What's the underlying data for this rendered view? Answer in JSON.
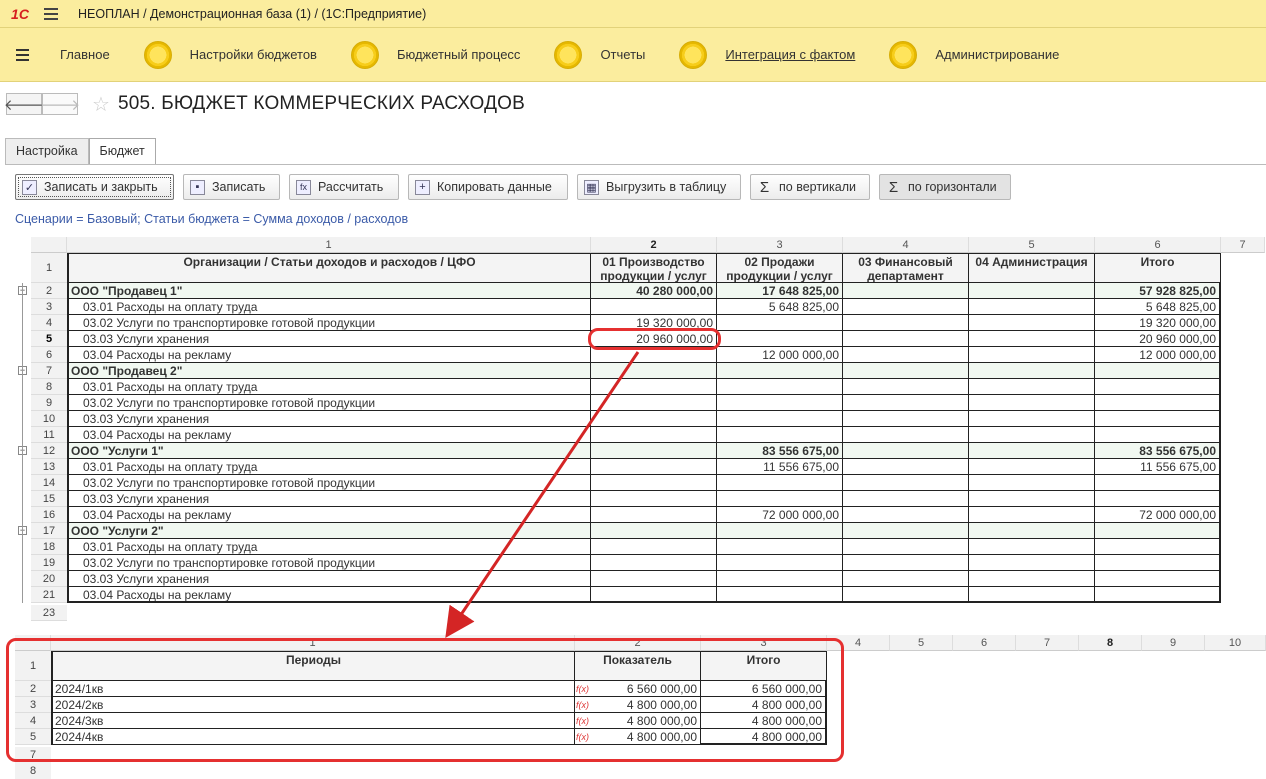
{
  "window": {
    "title": "НЕОПЛАН / Демонстрационная база (1) /  (1С:Предприятие)",
    "logo": "1С"
  },
  "menu": [
    {
      "label": "Главное",
      "link": false
    },
    {
      "label": "Настройки бюджетов",
      "link": false
    },
    {
      "label": "Бюджетный процесс",
      "link": false
    },
    {
      "label": "Отчеты",
      "link": false
    },
    {
      "label": "Интеграция с фактом",
      "link": true
    },
    {
      "label": "Администрирование",
      "link": false
    }
  ],
  "nav": {
    "back_icon": "arrow-left-icon",
    "forward_icon": "arrow-right-icon",
    "favorite_icon": "star-icon"
  },
  "page": {
    "title": "505. БЮДЖЕТ КОММЕРЧЕСКИХ РАСХОДОВ"
  },
  "tabs": [
    {
      "label": "Настройка",
      "active": false
    },
    {
      "label": "Бюджет",
      "active": true
    }
  ],
  "toolbar": {
    "save_close": "Записать и закрыть",
    "save": "Записать",
    "calc": "Рассчитать",
    "copy": "Копировать данные",
    "export": "Выгрузить в таблицу",
    "vertical": "по вертикали",
    "horizontal": "по горизонтали"
  },
  "filter": "Сценарии = Базовый; Статьи бюджета = Сумма доходов / расходов",
  "main_table": {
    "col_numbers": [
      "1",
      "2",
      "3",
      "4",
      "5",
      "6",
      "7"
    ],
    "headers": [
      "Организации / Статьи доходов и расходов / ЦФО",
      "01 Производство продукции / услуг",
      "02 Продажи продукции / услуг",
      "03 Финансовый департамент",
      "04 Администрация",
      "Итого"
    ],
    "rows": [
      {
        "n": "2",
        "group": true,
        "name": "ООО \"Продавец 1\"",
        "c2": "40 280 000,00",
        "c3": "17 648 825,00",
        "c4": "",
        "c5": "",
        "c6": "57 928 825,00"
      },
      {
        "n": "3",
        "group": false,
        "name": "03.01 Расходы на оплату труда",
        "c2": "",
        "c3": "5 648 825,00",
        "c4": "",
        "c5": "",
        "c6": "5 648 825,00"
      },
      {
        "n": "4",
        "group": false,
        "name": "03.02 Услуги по транспортировке готовой продукции",
        "c2": "19 320 000,00",
        "c3": "",
        "c4": "",
        "c5": "",
        "c6": "19 320 000,00"
      },
      {
        "n": "5",
        "group": false,
        "name": "03.03 Услуги хранения",
        "c2": "20 960 000,00",
        "c3": "",
        "c4": "",
        "c5": "",
        "c6": "20 960 000,00"
      },
      {
        "n": "6",
        "group": false,
        "name": "03.04 Расходы на рекламу",
        "c2": "",
        "c3": "12 000 000,00",
        "c4": "",
        "c5": "",
        "c6": "12 000 000,00"
      },
      {
        "n": "7",
        "group": true,
        "name": "ООО \"Продавец 2\"",
        "c2": "",
        "c3": "",
        "c4": "",
        "c5": "",
        "c6": ""
      },
      {
        "n": "8",
        "group": false,
        "name": "03.01 Расходы на оплату труда",
        "c2": "",
        "c3": "",
        "c4": "",
        "c5": "",
        "c6": ""
      },
      {
        "n": "9",
        "group": false,
        "name": "03.02 Услуги по транспортировке готовой продукции",
        "c2": "",
        "c3": "",
        "c4": "",
        "c5": "",
        "c6": ""
      },
      {
        "n": "10",
        "group": false,
        "name": "03.03 Услуги хранения",
        "c2": "",
        "c3": "",
        "c4": "",
        "c5": "",
        "c6": ""
      },
      {
        "n": "11",
        "group": false,
        "name": "03.04 Расходы на рекламу",
        "c2": "",
        "c3": "",
        "c4": "",
        "c5": "",
        "c6": ""
      },
      {
        "n": "12",
        "group": true,
        "name": "ООО \"Услуги 1\"",
        "c2": "",
        "c3": "83 556 675,00",
        "c4": "",
        "c5": "",
        "c6": "83 556 675,00"
      },
      {
        "n": "13",
        "group": false,
        "name": "03.01 Расходы на оплату труда",
        "c2": "",
        "c3": "11 556 675,00",
        "c4": "",
        "c5": "",
        "c6": "11 556 675,00"
      },
      {
        "n": "14",
        "group": false,
        "name": "03.02 Услуги по транспортировке готовой продукции",
        "c2": "",
        "c3": "",
        "c4": "",
        "c5": "",
        "c6": ""
      },
      {
        "n": "15",
        "group": false,
        "name": "03.03 Услуги хранения",
        "c2": "",
        "c3": "",
        "c4": "",
        "c5": "",
        "c6": ""
      },
      {
        "n": "16",
        "group": false,
        "name": "03.04 Расходы на рекламу",
        "c2": "",
        "c3": "72 000 000,00",
        "c4": "",
        "c5": "",
        "c6": "72 000 000,00"
      },
      {
        "n": "17",
        "group": true,
        "name": "ООО \"Услуги 2\"",
        "c2": "",
        "c3": "",
        "c4": "",
        "c5": "",
        "c6": ""
      },
      {
        "n": "18",
        "group": false,
        "name": "03.01 Расходы на оплату труда",
        "c2": "",
        "c3": "",
        "c4": "",
        "c5": "",
        "c6": ""
      },
      {
        "n": "19",
        "group": false,
        "name": "03.02 Услуги по транспортировке готовой продукции",
        "c2": "",
        "c3": "",
        "c4": "",
        "c5": "",
        "c6": ""
      },
      {
        "n": "20",
        "group": false,
        "name": "03.03 Услуги хранения",
        "c2": "",
        "c3": "",
        "c4": "",
        "c5": "",
        "c6": ""
      },
      {
        "n": "21",
        "group": false,
        "name": "03.04 Расходы на рекламу",
        "c2": "",
        "c3": "",
        "c4": "",
        "c5": "",
        "c6": ""
      }
    ],
    "extra_row_numbers": [
      "23"
    ]
  },
  "detail_table": {
    "col_numbers": [
      "1",
      "2",
      "3",
      "4",
      "5",
      "6",
      "7",
      "8",
      "9",
      "10"
    ],
    "headers": [
      "Периоды",
      "Показатель",
      "Итого"
    ],
    "rows": [
      {
        "n": "2",
        "period": "2024/1кв",
        "value": "6 560 000,00",
        "total": "6 560 000,00"
      },
      {
        "n": "3",
        "period": "2024/2кв",
        "value": "4 800 000,00",
        "total": "4 800 000,00"
      },
      {
        "n": "4",
        "period": "2024/3кв",
        "value": "4 800 000,00",
        "total": "4 800 000,00"
      },
      {
        "n": "5",
        "period": "2024/4кв",
        "value": "4 800 000,00",
        "total": "4 800 000,00"
      }
    ],
    "extra_row_numbers": [
      "7",
      "8"
    ],
    "formula_icon": "f(x)"
  },
  "colors": {
    "accent_red": "#e53030",
    "menu_bg": "#fbed9e",
    "link_blue": "#3b5ba8"
  }
}
